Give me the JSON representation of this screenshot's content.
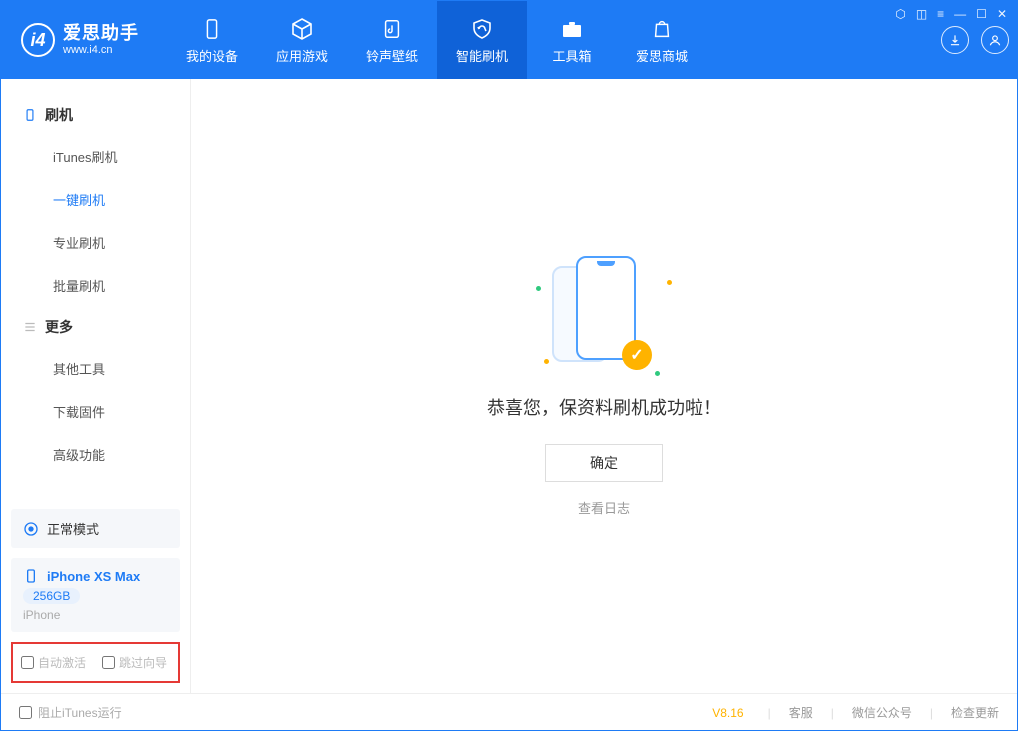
{
  "app": {
    "name_cn": "爱思助手",
    "name_en": "www.i4.cn",
    "logo_letter": "i4"
  },
  "tabs": [
    {
      "label": "我的设备"
    },
    {
      "label": "应用游戏"
    },
    {
      "label": "铃声壁纸"
    },
    {
      "label": "智能刷机",
      "active": true
    },
    {
      "label": "工具箱"
    },
    {
      "label": "爱思商城"
    }
  ],
  "sidebar": {
    "group1": {
      "title": "刷机",
      "items": [
        "iTunes刷机",
        "一键刷机",
        "专业刷机",
        "批量刷机"
      ],
      "active_index": 1
    },
    "group2": {
      "title": "更多",
      "items": [
        "其他工具",
        "下载固件",
        "高级功能"
      ]
    }
  },
  "device": {
    "mode": "正常模式",
    "name": "iPhone XS Max",
    "capacity": "256GB",
    "type": "iPhone"
  },
  "options": {
    "auto_activate": "自动激活",
    "skip_guide": "跳过向导"
  },
  "main": {
    "success_text": "恭喜您，保资料刷机成功啦！",
    "ok_button": "确定",
    "view_log": "查看日志"
  },
  "footer": {
    "block_itunes": "阻止iTunes运行",
    "version": "V8.16",
    "links": [
      "客服",
      "微信公众号",
      "检查更新"
    ]
  }
}
